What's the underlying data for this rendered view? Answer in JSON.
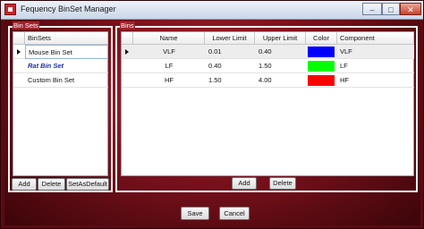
{
  "window": {
    "title": "Fequency BinSet Manager",
    "minimize": "–",
    "maximize": "□",
    "close": "✕"
  },
  "binsets": {
    "group_label": "Bin Sets",
    "header": "BinSets",
    "items": [
      {
        "label": "Mouse Bin Set",
        "style": "normal"
      },
      {
        "label": "Rat Bin Set",
        "style": "bold-italic-blue"
      },
      {
        "label": "Custom Bin Set",
        "style": "normal"
      }
    ],
    "add": "Add",
    "delete": "Delete",
    "set_default": "SetAsDefault"
  },
  "bins": {
    "group_label": "Bins",
    "columns": [
      "Name",
      "Lower Limit",
      "Upper Limit",
      "Color",
      "Component"
    ],
    "rows": [
      {
        "name": "VLF",
        "lower": "0.01",
        "upper": "0.40",
        "color": "#0000ff",
        "component": "VLF"
      },
      {
        "name": "LF",
        "lower": "0.40",
        "upper": "1.50",
        "color": "#00ff00",
        "component": "LF"
      },
      {
        "name": "HF",
        "lower": "1.50",
        "upper": "4.00",
        "color": "#ff0000",
        "component": "HF"
      }
    ],
    "add": "Add",
    "delete": "Delete"
  },
  "footer": {
    "save": "Save",
    "cancel": "Cancel"
  }
}
